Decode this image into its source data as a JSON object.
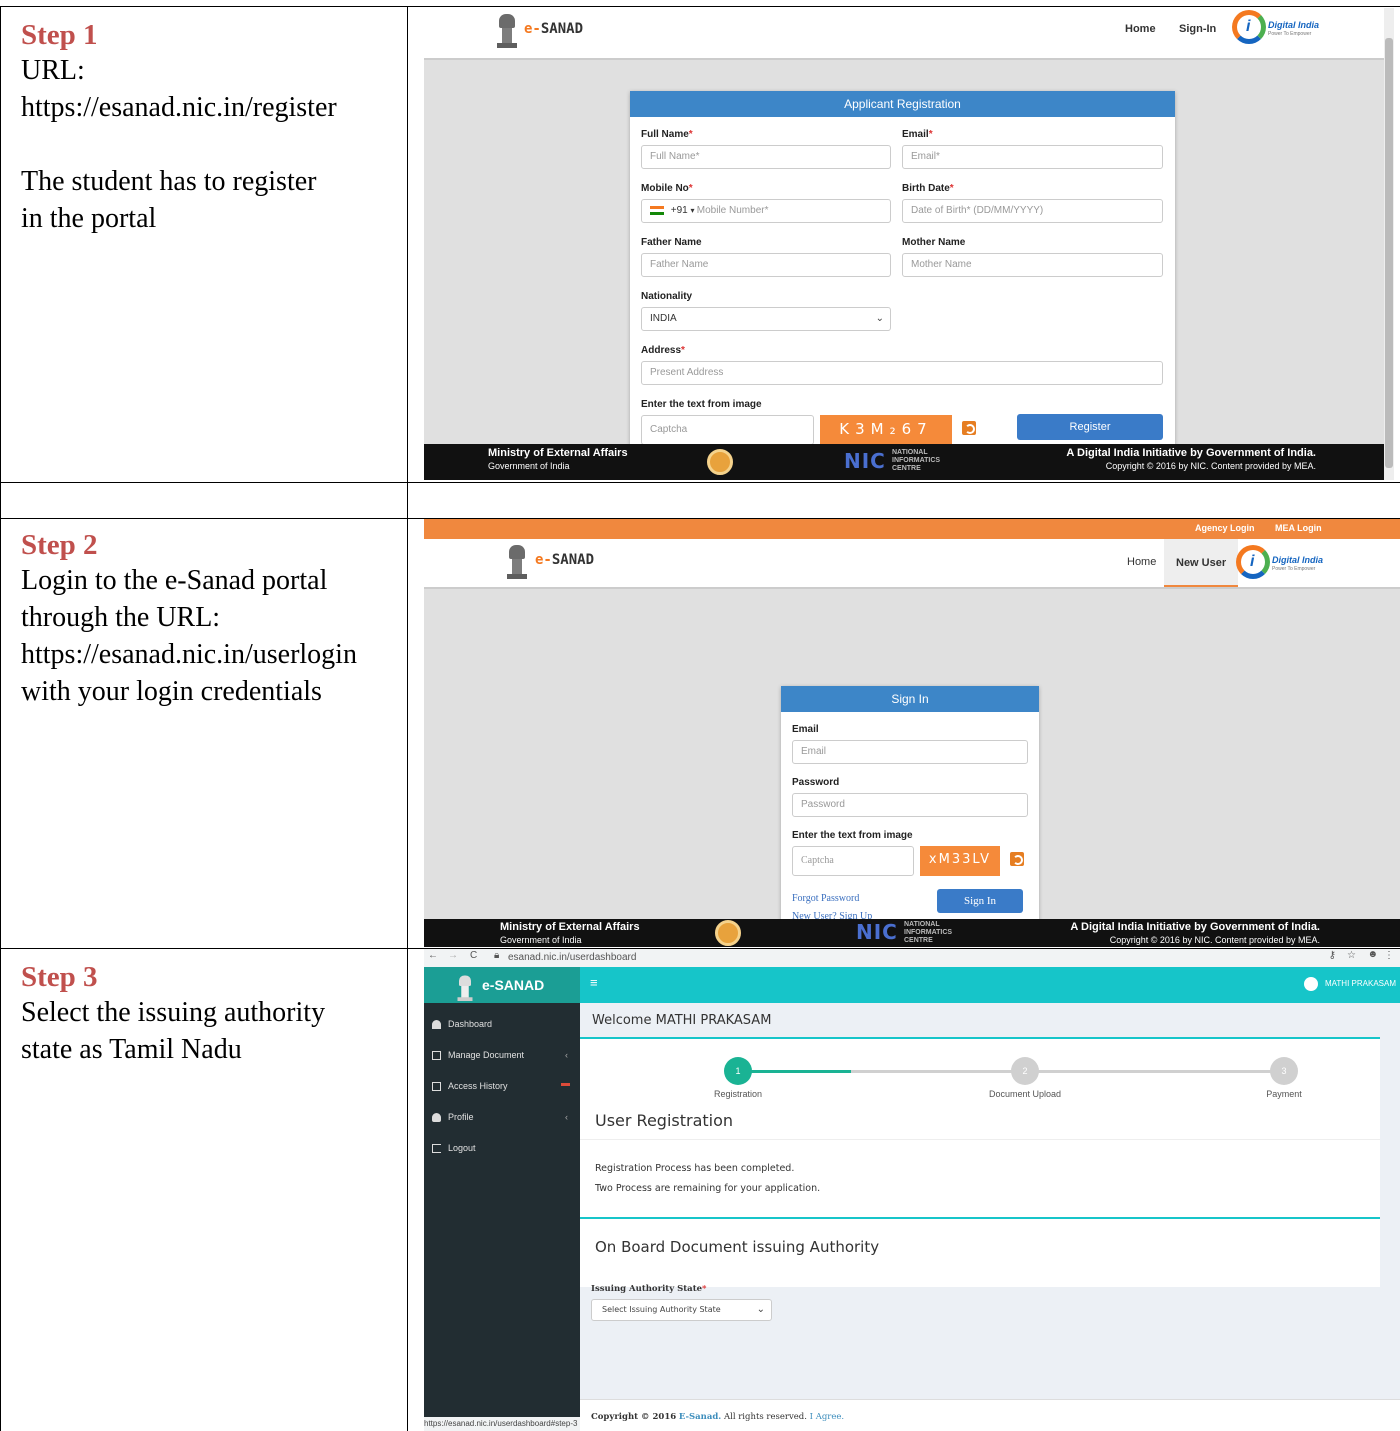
{
  "steps": [
    {
      "title": "Step 1",
      "lines": [
        "URL:",
        "https://esanad.nic.in/register",
        "",
        "The student has to register",
        "in the portal"
      ]
    },
    {
      "title": "Step 2",
      "lines": [
        "Login to the e-Sanad portal",
        "through the URL:",
        "https://esanad.nic.in/userlogin",
        "with your login credentials"
      ]
    },
    {
      "title": "Step 3",
      "lines": [
        "Select the issuing authority",
        "state as Tamil Nadu"
      ]
    }
  ],
  "site": {
    "brand_prefix": "e-",
    "brand_suffix": "SANAD",
    "digital_india": "Digital India",
    "digital_india_tagline": "Power To Empower",
    "footer_left_title": "Ministry of External Affairs",
    "footer_left_sub": "Government of India",
    "footer_right_title": "A Digital India Initiative by Government of India.",
    "footer_right_sub": "Copyright © 2016 by NIC. Content provided by MEA.",
    "nic_logo": "NIC",
    "nic_text": [
      "NATIONAL",
      "INFORMATICS",
      "CENTRE"
    ]
  },
  "register": {
    "nav": [
      "Home",
      "Sign-In"
    ],
    "panel_title": "Applicant Registration",
    "full_name_label": "Full Name",
    "full_name_ph": "Full Name*",
    "email_label": "Email",
    "email_ph": "Email*",
    "mobile_label": "Mobile No",
    "country_code": "+91",
    "mobile_ph": "Mobile Number*",
    "birth_label": "Birth Date",
    "birth_ph": "Date of Birth* (DD/MM/YYYY)",
    "father_label": "Father Name",
    "father_ph": "Father Name",
    "mother_label": "Mother Name",
    "mother_ph": "Mother Name",
    "nationality_label": "Nationality",
    "nationality_value": "INDIA",
    "address_label": "Address",
    "address_ph": "Present Address",
    "captcha_label": "Enter the text from image",
    "captcha_ph": "Captcha",
    "captcha_text": "K3M₂67",
    "register_button": "Register",
    "required_mark": "*"
  },
  "signin": {
    "top_links": [
      "Agency Login",
      "MEA Login"
    ],
    "nav": [
      "Home",
      "New User"
    ],
    "panel_title": "Sign In",
    "email_label": "Email",
    "email_ph": "Email",
    "password_label": "Password",
    "password_ph": "Password",
    "captcha_label": "Enter the text from image",
    "captcha_ph": "Captcha",
    "captcha_text": "xM33LV",
    "forgot_link": "Forgot Password",
    "new_user_link": "New User? Sign Up",
    "signin_button": "Sign In"
  },
  "dashboard": {
    "url": "esanad.nic.in/userdashboard",
    "brand": "e-SANAD",
    "user": "MATHI PRAKASAM",
    "menu_icon": "hamburger-icon",
    "sidebar": [
      {
        "label": "Dashboard",
        "chevron": ""
      },
      {
        "label": "Manage Document",
        "chevron": "‹"
      },
      {
        "label": "Access History",
        "chevron": ""
      },
      {
        "label": "Profile",
        "chevron": "‹"
      },
      {
        "label": "Logout",
        "chevron": ""
      }
    ],
    "welcome": "Welcome MATHI PRAKASAM",
    "stepper": [
      {
        "num": "1",
        "label": "Registration"
      },
      {
        "num": "2",
        "label": "Document Upload"
      },
      {
        "num": "3",
        "label": "Payment"
      }
    ],
    "user_registration_title": "User Registration",
    "message_1": "Registration Process has been completed.",
    "message_2": "Two Process are remaining for your application.",
    "onboard_title": "On Board Document issuing Authority",
    "state_label": "Issuing Authority State",
    "state_required": "*",
    "state_placeholder": "Select Issuing Authority State",
    "copyright_prefix": "Copyright © 2016",
    "copyright_brand": "E-Sanad.",
    "copyright_rest": "All rights reserved.",
    "agree_link": "I Agree.",
    "status_url": "https://esanad.nic.in/userdashboard#step-3",
    "colors": {
      "teal": "#16c5c9",
      "step_active": "#1ab394",
      "step_inactive": "#d0d0d0"
    }
  }
}
